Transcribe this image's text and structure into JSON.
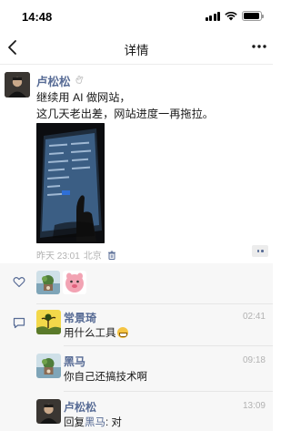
{
  "status_bar": {
    "time": "14:48",
    "battery_level": 0.95
  },
  "nav": {
    "title": "详情",
    "back_icon": "chevron-left-icon",
    "more_icon": "more-dots-icon"
  },
  "post": {
    "author": "卢松松",
    "text_lines": [
      "继续用 AI 做网站，",
      "这几天老出差，网站进度一再拖拉。"
    ],
    "time": "昨天 23:01",
    "location": "北京",
    "delete_icon": "trash-icon"
  },
  "likes": {
    "icon": "heart-icon"
  },
  "comments": [
    {
      "name": "常景琦",
      "time": "02:41",
      "text": "用什么工具",
      "emoji": "grin-emoji"
    },
    {
      "name": "黑马",
      "time": "09:18",
      "text": "你自己还搞技术啊"
    },
    {
      "name": "卢松松",
      "time": "13:09",
      "reply_prefix": "回复",
      "reply_to": "黑马",
      "reply_sep": ": ",
      "text": "对"
    }
  ],
  "colors": {
    "link": "#576b95",
    "meta": "#b2b2b2",
    "comment_bg": "#f7f7f7"
  }
}
